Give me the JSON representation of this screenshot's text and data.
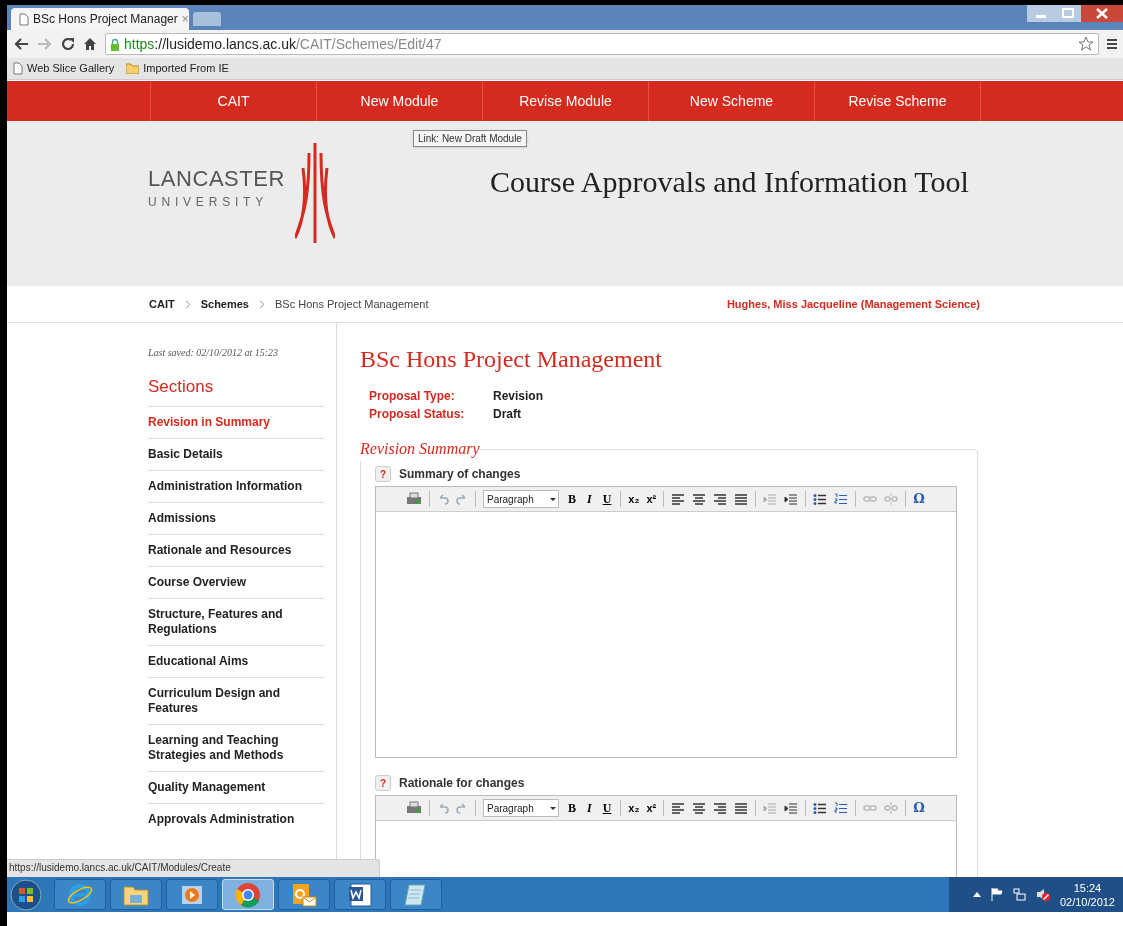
{
  "browser": {
    "tab_title": "BSc Hons Project Manager",
    "tab_close": "×",
    "url_scheme": "https",
    "url_host": "://lusidemo.lancs.ac.uk",
    "url_path": "/CAIT/Schemes/Edit/47",
    "bookmarks": [
      {
        "kind": "page",
        "label": "Web Slice Gallery"
      },
      {
        "kind": "folder",
        "label": "Imported From IE"
      }
    ],
    "status_url": "https://lusidemo.lancs.ac.uk/CAIT/Modules/Create"
  },
  "nav": [
    {
      "label": "CAIT"
    },
    {
      "label": "New Module"
    },
    {
      "label": "Revise Module"
    },
    {
      "label": "New Scheme"
    },
    {
      "label": "Revise Scheme"
    }
  ],
  "tooltip": "Link: New Draft Module",
  "header": {
    "logo_line1": "LANCASTER",
    "logo_line2": "UNIVERSITY",
    "title": "Course Approvals and Information Tool"
  },
  "breadcrumb": [
    "CAIT",
    "Schemes",
    "BSc Hons Project Management"
  ],
  "user": "Hughes, Miss Jacqueline (Management Science)",
  "sidebar": {
    "last_saved": "Last saved: 02/10/2012 at 15:23",
    "heading": "Sections",
    "items": [
      {
        "label": "Revision in Summary",
        "selected": true
      },
      {
        "label": "Basic Details",
        "selected": false
      },
      {
        "label": "Administration Information",
        "selected": false
      },
      {
        "label": "Admissions",
        "selected": false
      },
      {
        "label": "Rationale and Resources",
        "selected": false
      },
      {
        "label": "Course Overview",
        "selected": false
      },
      {
        "label": "Structure, Features and Regulations",
        "selected": false
      },
      {
        "label": "Educational Aims",
        "selected": false
      },
      {
        "label": "Curriculum Design and Features",
        "selected": false
      },
      {
        "label": "Learning and Teaching Strategies and Methods",
        "selected": false
      },
      {
        "label": "Quality Management",
        "selected": false
      },
      {
        "label": "Approvals Administration",
        "selected": false
      }
    ]
  },
  "main": {
    "title": "BSc Hons Project Management",
    "fields": [
      {
        "label": "Proposal Type:",
        "value": "Revision"
      },
      {
        "label": "Proposal Status:",
        "value": "Draft"
      }
    ],
    "fieldset": "Revision Summary",
    "editors": [
      {
        "help": "?",
        "label": "Summary of changes",
        "format": "Paragraph",
        "bold": "B",
        "italic": "I",
        "underline": "U",
        "subscript": "x₂",
        "superscript": "x²",
        "special": "Ω"
      },
      {
        "help": "?",
        "label": "Rationale for changes",
        "format": "Paragraph",
        "bold": "B",
        "italic": "I",
        "underline": "U",
        "subscript": "x₂",
        "superscript": "x²",
        "special": "Ω"
      }
    ]
  },
  "taskbar": {
    "apps": [
      {
        "kind": "ie",
        "active": false
      },
      {
        "kind": "folder",
        "active": false
      },
      {
        "kind": "media",
        "active": false
      },
      {
        "kind": "chrome",
        "active": true
      },
      {
        "kind": "outlook",
        "active": false
      },
      {
        "kind": "word",
        "active": false
      },
      {
        "kind": "notepad",
        "active": false
      }
    ],
    "time": "15:24",
    "date": "02/10/2012"
  }
}
